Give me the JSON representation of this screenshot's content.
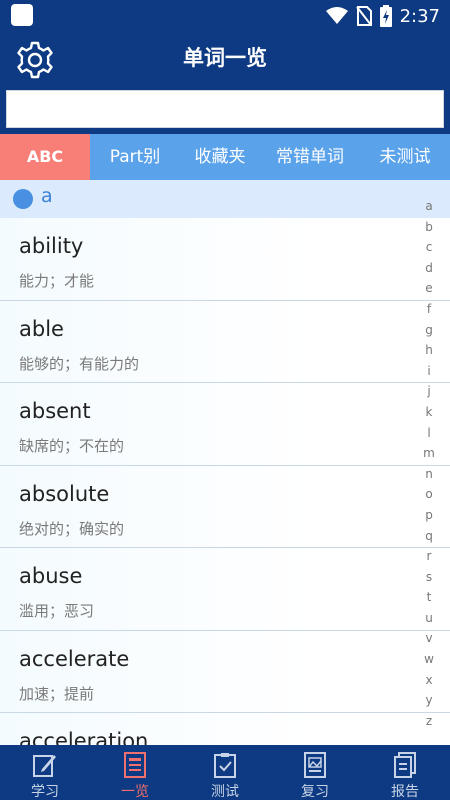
{
  "status": {
    "time": "2:37"
  },
  "header": {
    "title": "单词一览"
  },
  "search": {
    "value": "",
    "placeholder": ""
  },
  "tabs": [
    {
      "label": "ABC",
      "active": true
    },
    {
      "label": "Part别"
    },
    {
      "label": "收藏夹"
    },
    {
      "label": "常错单词"
    },
    {
      "label": "未测试"
    }
  ],
  "section": {
    "letter": "a"
  },
  "words": [
    {
      "word": "ability",
      "meaning": "能力；才能"
    },
    {
      "word": "able",
      "meaning": "能够的；有能力的"
    },
    {
      "word": "absent",
      "meaning": "缺席的；不在的"
    },
    {
      "word": "absolute",
      "meaning": "绝对的；确实的"
    },
    {
      "word": "abuse",
      "meaning": "滥用；恶习"
    },
    {
      "word": "accelerate",
      "meaning": "加速；提前"
    },
    {
      "word": "acceleration",
      "meaning": ""
    }
  ],
  "alphabet": [
    "a",
    "b",
    "c",
    "d",
    "e",
    "f",
    "g",
    "h",
    "i",
    "j",
    "k",
    "l",
    "m",
    "n",
    "o",
    "p",
    "q",
    "r",
    "s",
    "t",
    "u",
    "v",
    "w",
    "x",
    "y",
    "z"
  ],
  "bottom_nav": [
    {
      "label": "学习",
      "icon": "pencil-note-icon"
    },
    {
      "label": "一览",
      "icon": "list-doc-icon",
      "active": true
    },
    {
      "label": "测试",
      "icon": "clipboard-check-icon"
    },
    {
      "label": "复习",
      "icon": "picture-doc-icon"
    },
    {
      "label": "报告",
      "icon": "report-doc-icon"
    }
  ],
  "colors": {
    "primary": "#0d3a82",
    "tab_bar": "#5aa2ea",
    "tab_active": "#f77f77",
    "section_bg": "#dbeafc",
    "nav_active": "#f06f6f"
  }
}
